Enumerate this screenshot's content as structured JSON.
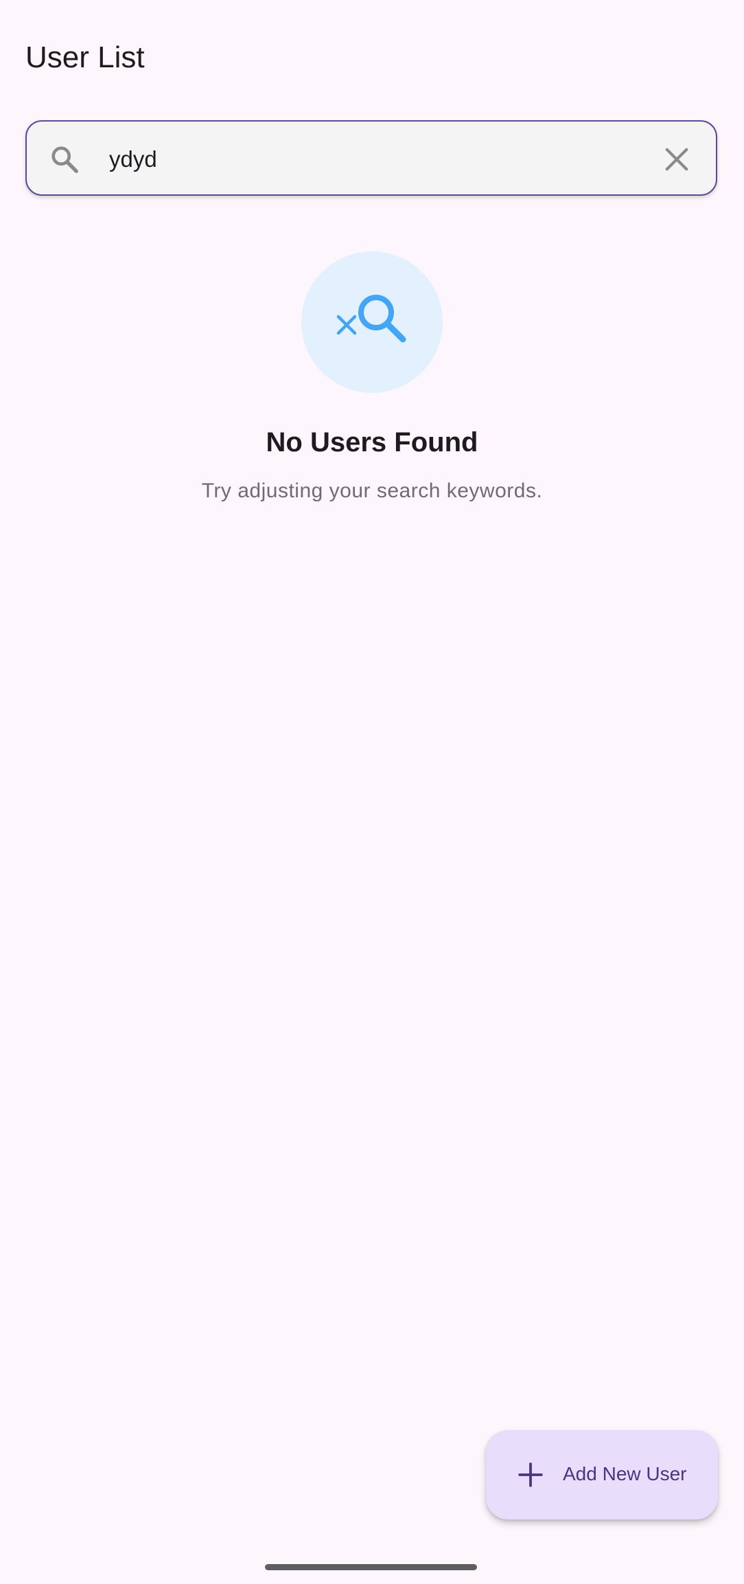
{
  "app": {
    "title": "User List"
  },
  "search": {
    "value": "ydyd",
    "placeholder": "",
    "search_icon": "search-icon",
    "clear_icon": "close-icon"
  },
  "empty_state": {
    "icon": "search-off-icon",
    "title": "No Users Found",
    "subtitle": "Try adjusting your search keywords."
  },
  "fab": {
    "icon": "add-icon",
    "label": "Add New User"
  },
  "colors": {
    "background": "#fdf7fd",
    "accent": "#5b4a9a",
    "empty_icon": "#42a5f5",
    "empty_circle": "#e2f1fd",
    "fab_background": "#e9ddfc",
    "fab_text": "#4a3582"
  }
}
